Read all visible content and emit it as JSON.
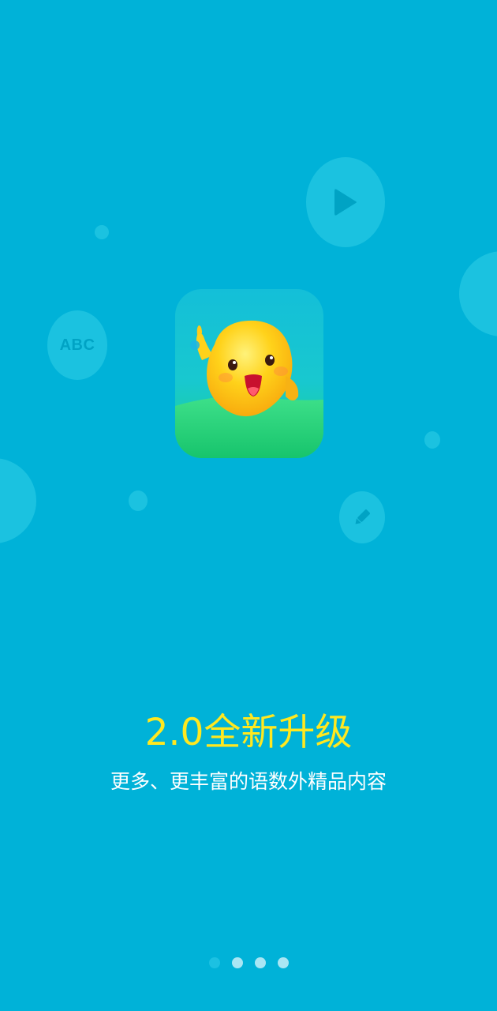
{
  "splash": {
    "title": "2.0全新升级",
    "subtitle": "更多、更丰富的语数外精品内容",
    "abc_label": "ABC",
    "page_indicator": {
      "total": 4,
      "active_index": 0
    }
  },
  "colors": {
    "background": "#00b2d8",
    "title": "#ffe81f",
    "subtitle": "#ffffff",
    "bubble": "#1bc2e0",
    "bubble_icon": "#00a3c4"
  },
  "icons": {
    "app": "mascot-app-icon",
    "play": "play-icon",
    "edit": "pencil-icon"
  }
}
